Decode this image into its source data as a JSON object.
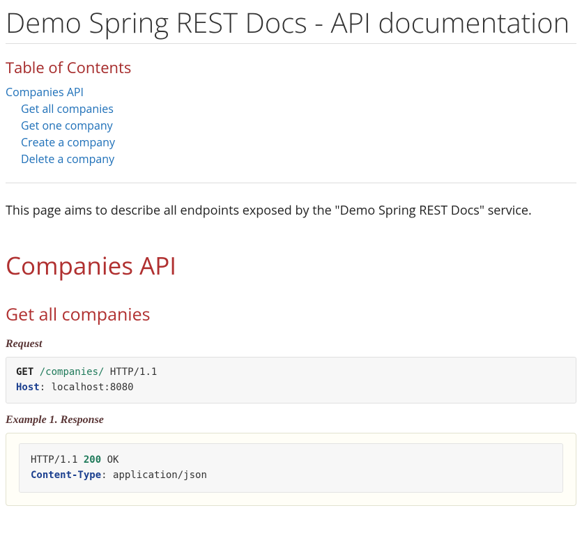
{
  "title": "Demo Spring REST Docs - API documentation",
  "toc": {
    "heading": "Table of Contents",
    "top": "Companies API",
    "items": [
      "Get all companies",
      "Get one company",
      "Create a company",
      "Delete a company"
    ]
  },
  "intro": "This page aims to describe all endpoints exposed by the \"Demo Spring REST Docs\" service.",
  "section": {
    "title": "Companies API"
  },
  "sub1": {
    "title": "Get all companies"
  },
  "request": {
    "label": "Request",
    "method": "GET",
    "path": "/companies/",
    "http_version": "HTTP/1.1",
    "host_header": "Host",
    "host_value": "localhost:8080"
  },
  "response": {
    "label": "Example 1. Response",
    "http_version": "HTTP/1.1",
    "status_code": "200",
    "status_text": "OK",
    "content_type_header": "Content-Type",
    "content_type_value": "application/json"
  }
}
